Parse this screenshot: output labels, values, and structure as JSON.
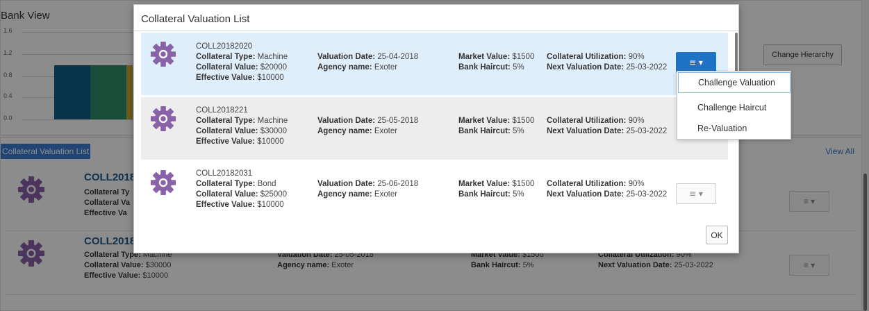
{
  "background": {
    "bank_view_title": "Bank View",
    "chart_ticks": [
      "1.6",
      "1.2",
      "0.8",
      "0.4",
      "0.0"
    ],
    "chart_colors": [
      "#0d5f86",
      "#2c8c6a",
      "#c9a93a"
    ],
    "change_hierarchy_label": "Change Hierarchy",
    "list_title": "Collateral Valuation List",
    "view_all_label": "View All",
    "rows": [
      {
        "id": "COLL2018",
        "type_label": "Collateral Ty",
        "value_label": "Collateral Va",
        "effective_label": "Effective Va"
      },
      {
        "id": "COLL2018",
        "type_label": "Collateral Type:",
        "type_value": "Machine",
        "value_label": "Collateral Value:",
        "value_value": "$30000",
        "effective_label": "Effective Value:",
        "effective_value": "$10000",
        "valuation_date_label": "Valuation Date:",
        "valuation_date": "25-05-2018",
        "agency_label": "Agency name:",
        "agency": "Exoter",
        "market_label": "Market Value:",
        "market": "$1500",
        "haircut_label": "Bank Haircut:",
        "haircut": "5%",
        "utilization_label": "Collateral Utilization:",
        "utilization": "90%",
        "next_label": "Next Valuation Date:",
        "next": "25-03-2022"
      }
    ],
    "menu_icon": "≡ ▾"
  },
  "modal": {
    "title": "Collateral Valuation List",
    "ok_label": "OK",
    "rows": [
      {
        "id": "COLL20182020",
        "type_label": "Collateral Type:",
        "type_value": "Machine",
        "value_label": "Collateral Value:",
        "value_value": "$20000",
        "effective_label": "Effective Value:",
        "effective_value": "$10000",
        "valuation_date_label": "Valuation Date:",
        "valuation_date": "25-04-2018",
        "agency_label": "Agency name:",
        "agency": "Exoter",
        "market_label": "Market Value:",
        "market": "$1500",
        "haircut_label": "Bank Haircut:",
        "haircut": "5%",
        "utilization_label": "Collateral Utilization:",
        "utilization": "90%",
        "next_label": "Next Valuation Date:",
        "next": "25-03-2022",
        "menu_icon": "≡ ▾"
      },
      {
        "id": "COLL2018221",
        "type_label": "Collateral Type:",
        "type_value": "Machine",
        "value_label": "Collateral Value:",
        "value_value": "$30000",
        "effective_label": "Effective Value:",
        "effective_value": "$10000",
        "valuation_date_label": "Valuation Date:",
        "valuation_date": "25-05-2018",
        "agency_label": "Agency name:",
        "agency": "Exoter",
        "market_label": "Market Value:",
        "market": "$1500",
        "haircut_label": "Bank Haircut:",
        "haircut": "5%",
        "utilization_label": "Collateral Utilization:",
        "utilization": "90%",
        "next_label": "Next Valuation Date:",
        "next": "25-03-2022"
      },
      {
        "id": "COLL20182031",
        "type_label": "Collateral Type:",
        "type_value": "Bond",
        "value_label": "Collateral Value:",
        "value_value": "$25000",
        "effective_label": "Effective Value:",
        "effective_value": "$10000",
        "valuation_date_label": "Valuation Date:",
        "valuation_date": "25-06-2018",
        "agency_label": "Agency name:",
        "agency": "Exoter",
        "market_label": "Market Value:",
        "market": "$1500",
        "haircut_label": "Bank Haircut:",
        "haircut": "5%",
        "utilization_label": "Collateral Utilization:",
        "utilization": "90%",
        "next_label": "Next Valuation Date:",
        "next": "25-03-2022",
        "menu_icon": "≡ ▾"
      }
    ]
  },
  "dropdown": {
    "items": [
      "Challenge Valuation",
      "Challenge Haircut",
      "Re-Valuation"
    ]
  },
  "colors": {
    "accent": "#1e73c8",
    "gear": "#8a62a8",
    "selected_row": "#deeefa"
  },
  "icons": {
    "gear": "gear-icon",
    "menu": "hamburger-menu-icon"
  }
}
